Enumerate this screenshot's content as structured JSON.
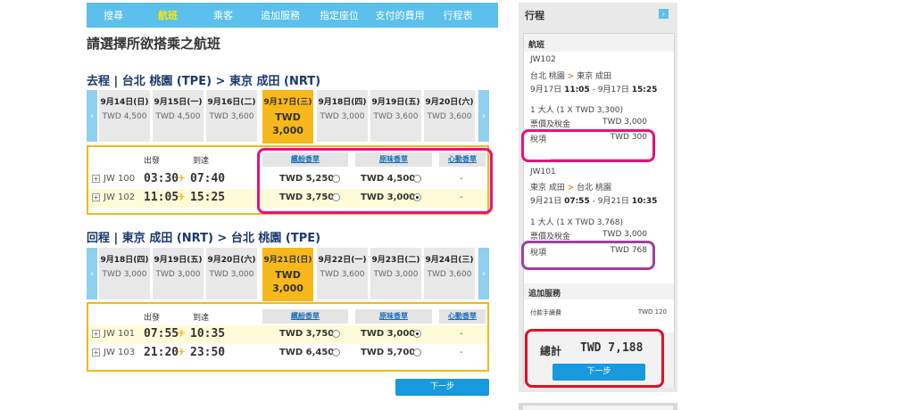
{
  "nav": {
    "items": [
      "搜尋",
      "航班",
      "乘客",
      "追加服務",
      "指定座位",
      "支付的費用",
      "行程表"
    ],
    "active_index": 1
  },
  "page_title": "請選擇所欲搭乘之航班",
  "outbound": {
    "title": "去程 | 台北 桃園 (TPE) > 東京 成田 (NRT)",
    "dates": [
      {
        "date": "9月14日(日)",
        "price": "TWD 4,500"
      },
      {
        "date": "9月15日(一)",
        "price": "TWD 4,500"
      },
      {
        "date": "9月16日(二)",
        "price": "TWD 3,600"
      },
      {
        "date": "9月17日(三)",
        "price": "TWD 3,000"
      },
      {
        "date": "9月18日(四)",
        "price": "TWD 3,000"
      },
      {
        "date": "9月19日(五)",
        "price": "TWD 3,600"
      },
      {
        "date": "9月20日(六)",
        "price": "TWD 3,600"
      }
    ],
    "selected_date_index": 3,
    "headers": {
      "depart": "出發",
      "arrive": "到達",
      "fare1": "繽紛香草",
      "fare2": "原味香草",
      "fare3": "心動香草"
    },
    "flights": [
      {
        "no": "JW 100",
        "dep": "03:30",
        "arr": "07:40",
        "fare1": "TWD 5,250",
        "fare2": "TWD 4,500",
        "fare3": "-"
      },
      {
        "no": "JW 102",
        "dep": "11:05",
        "arr": "15:25",
        "fare1": "TWD 3,750",
        "fare2": "TWD 3,000",
        "fare3": "-"
      }
    ]
  },
  "return": {
    "title": "回程 | 東京 成田 (NRT) > 台北 桃園 (TPE)",
    "dates": [
      {
        "date": "9月18日(四)",
        "price": "TWD 3,000"
      },
      {
        "date": "9月19日(五)",
        "price": "TWD 3,000"
      },
      {
        "date": "9月20日(六)",
        "price": "TWD 3,000"
      },
      {
        "date": "9月21日(日)",
        "price": "TWD 3,000"
      },
      {
        "date": "9月22日(一)",
        "price": "TWD 3,600"
      },
      {
        "date": "9月23日(二)",
        "price": "TWD 3,000"
      },
      {
        "date": "9月24日(三)",
        "price": "TWD 3,600"
      }
    ],
    "selected_date_index": 3,
    "headers": {
      "depart": "出發",
      "arrive": "到達",
      "fare1": "繽紛香草",
      "fare2": "原味香草",
      "fare3": "心動香草"
    },
    "flights": [
      {
        "no": "JW 101",
        "dep": "07:55",
        "arr": "10:35",
        "fare1": "TWD 3,750",
        "fare2": "TWD 3,000",
        "fare3": "-"
      },
      {
        "no": "JW 103",
        "dep": "21:20",
        "arr": "23:50",
        "fare1": "TWD 6,450",
        "fare2": "TWD 5,700",
        "fare3": "-"
      }
    ]
  },
  "next_label": "下一步",
  "sidebar": {
    "title": "行程",
    "toggle_icon": "›",
    "flights_section": "航班",
    "leg1": {
      "flight": "JW102",
      "route_from": "台北 桃園",
      "route_arrow": ">",
      "route_to": "東京 成田",
      "date_from": "9月17日",
      "time_from": "11:05",
      "sep": "-",
      "date_to": "9月17日",
      "time_to": "15:25",
      "pax": "1 大人 (1 X TWD 3,300)",
      "fare_label": "票價及稅金",
      "fare_value": "TWD 3,000",
      "tax_label": "稅項",
      "tax_value": "TWD 300"
    },
    "leg2": {
      "flight": "JW101",
      "route_from": "東京 成田",
      "route_arrow": ">",
      "route_to": "台北 桃園",
      "date_from": "9月21日",
      "time_from": "07:55",
      "sep": "-",
      "date_to": "9月21日",
      "time_to": "10:35",
      "pax": "1 大人 (1 X TWD 3,768)",
      "fare_label": "票價及稅金",
      "fare_value": "TWD 3,000",
      "tax_label": "稅項",
      "tax_value": "TWD 768"
    },
    "extras_section": "追加服務",
    "fee_label": "付款手續費",
    "fee_value": "TWD 120",
    "total_label": "總計",
    "total_value": "TWD 7,188",
    "next_label": "下一步"
  },
  "colors": {
    "nav_bg": "#5bc0eb",
    "accent_yellow": "#f6b81a",
    "button_blue": "#1899dd",
    "highlight_pink": "#e8117f",
    "highlight_purple": "#a040a0",
    "highlight_red": "#e0102a"
  }
}
